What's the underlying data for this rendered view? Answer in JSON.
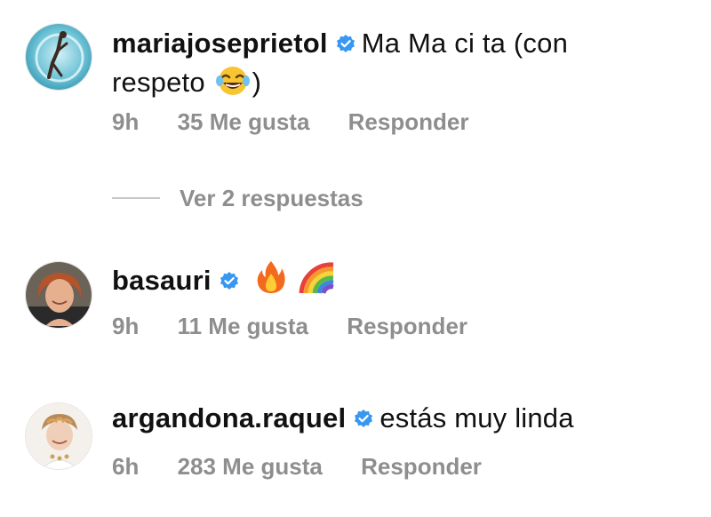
{
  "comments": [
    {
      "username": "mariajoseprietol",
      "text_line1": "Ma Ma ci ta (con",
      "text_line2_before": "respeto",
      "text_line2_after": ")",
      "emoji": "face-with-tears-of-joy",
      "time": "9h",
      "likes": "35 Me gusta",
      "reply": "Responder"
    },
    {
      "username": "basauri",
      "emojis": [
        "fire",
        "rainbow"
      ],
      "time": "9h",
      "likes": "11 Me gusta",
      "reply": "Responder"
    },
    {
      "username": "argandona.raquel",
      "text": "estás muy linda",
      "time": "6h",
      "likes": "283 Me gusta",
      "reply": "Responder"
    }
  ],
  "replies_toggle": {
    "label": "Ver 2 respuestas"
  },
  "colors": {
    "verified_blue": "#3897f0",
    "meta_gray": "#8e8e8e",
    "text": "#111111"
  }
}
